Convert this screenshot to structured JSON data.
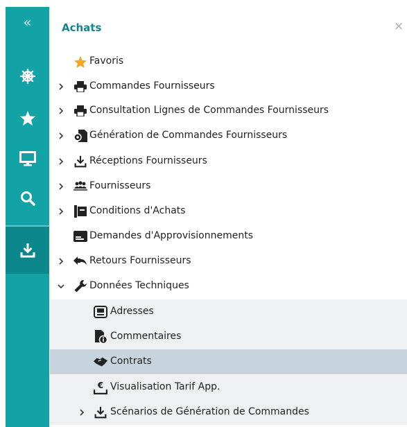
{
  "panel": {
    "title": "Achats",
    "close_symbol": "×"
  },
  "sidebar": {
    "collapse_symbol": "«"
  },
  "menu": {
    "favoris": "Favoris",
    "commandes": "Commandes Fournisseurs",
    "consultation": "Consultation Lignes de Commandes Fournisseurs",
    "generation": "Génération de Commandes Fournisseurs",
    "receptions": "Réceptions Fournisseurs",
    "fournisseurs": "Fournisseurs",
    "conditions": "Conditions d'Achats",
    "demandes": "Demandes d'Approvisionnements",
    "retours": "Retours Fournisseurs",
    "donnees": "Données Techniques",
    "adresses": "Adresses",
    "commentaires": "Commentaires",
    "contrats": "Contrats",
    "visualisation": "Visualisation Tarif App.",
    "scenarios": "Scénarios de Génération de Commandes"
  },
  "colors": {
    "sidebar": "#13a2a6",
    "sidebar_active": "#0c878b",
    "title": "#13868a",
    "star": "#f5a623",
    "selected_row": "#c7d4de"
  }
}
